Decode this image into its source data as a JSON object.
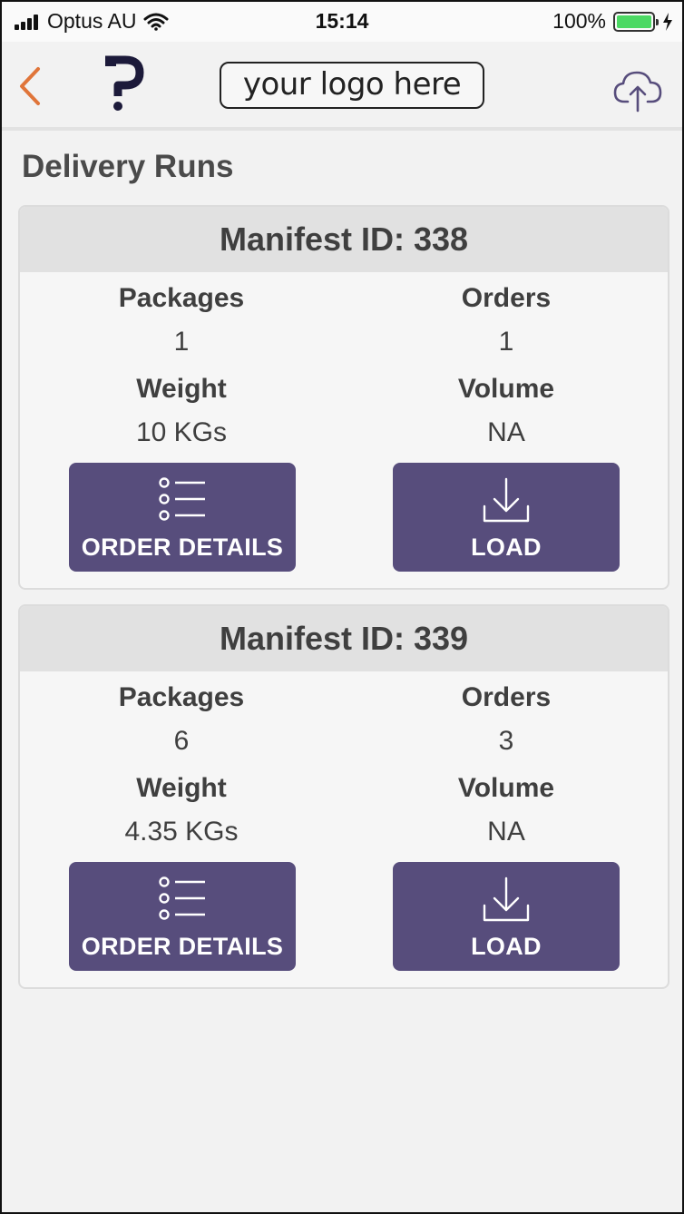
{
  "status_bar": {
    "carrier": "Optus AU",
    "time": "15:14",
    "battery": "100%"
  },
  "header": {
    "logo_text": "your logo here",
    "back_icon": "chevron-left-icon",
    "upload_icon": "cloud-upload-icon",
    "accent_color": "#e0753a"
  },
  "page": {
    "title": "Delivery Runs"
  },
  "manifests": [
    {
      "title": "Manifest ID: 338",
      "packages_label": "Packages",
      "packages": "1",
      "orders_label": "Orders",
      "orders": "1",
      "weight_label": "Weight",
      "weight": "10 KGs",
      "volume_label": "Volume",
      "volume": "NA",
      "details_label": "ORDER DETAILS",
      "load_label": "LOAD"
    },
    {
      "title": "Manifest ID: 339",
      "packages_label": "Packages",
      "packages": "6",
      "orders_label": "Orders",
      "orders": "3",
      "weight_label": "Weight",
      "weight": "4.35 KGs",
      "volume_label": "Volume",
      "volume": "NA",
      "details_label": "ORDER DETAILS",
      "load_label": "LOAD"
    }
  ],
  "colors": {
    "button": "#574d7c",
    "card_header": "#e1e1e1"
  }
}
